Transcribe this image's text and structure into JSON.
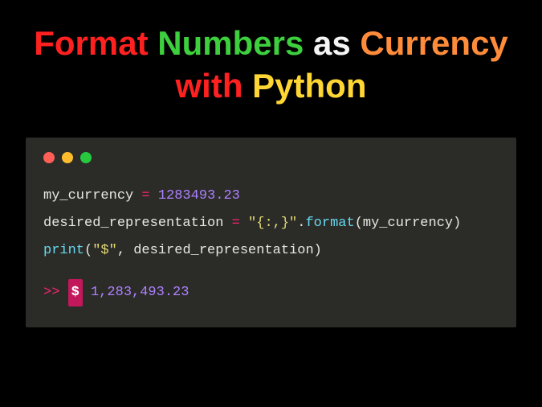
{
  "title": {
    "format": "Format",
    "numbers": "Numbers",
    "as": "as",
    "currency": "Currency",
    "with": "with",
    "python": "Python"
  },
  "code": {
    "line1": {
      "var": "my_currency",
      "eq": "=",
      "num": "1283493.23"
    },
    "line2": {
      "var": "desired_representation",
      "eq": "=",
      "str": "\"{:,}\"",
      "dot": ".",
      "method": "format",
      "arg": "my_currency"
    },
    "line3": {
      "func": "print",
      "arg1": "\"$\"",
      "comma": ",",
      "arg2": "desired_representation"
    },
    "output": {
      "prompt": ">>",
      "dollar": "$",
      "value": "1,283,493.23"
    }
  }
}
